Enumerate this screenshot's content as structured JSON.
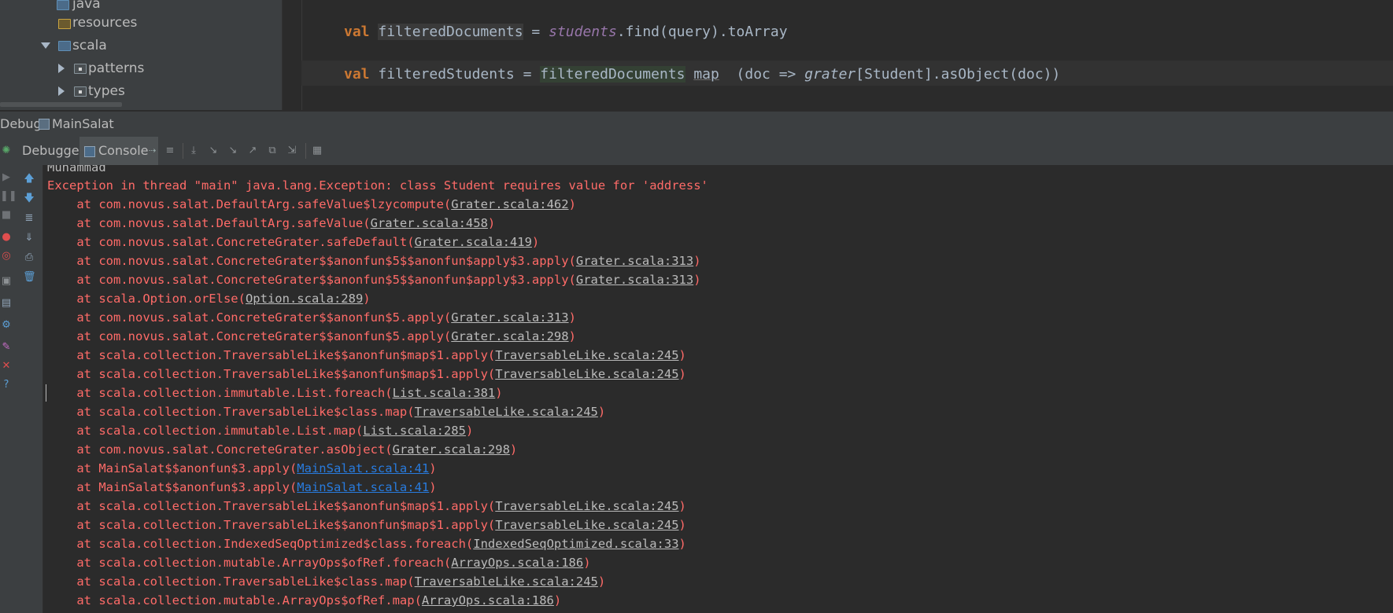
{
  "project_tree": {
    "items": [
      {
        "label": "java",
        "kind": "folder"
      },
      {
        "label": "resources",
        "kind": "resources"
      },
      {
        "label": "scala",
        "kind": "source",
        "expanded": true
      },
      {
        "label": "patterns",
        "kind": "package",
        "expanded": false
      },
      {
        "label": "types",
        "kind": "package",
        "expanded": false
      }
    ]
  },
  "editor": {
    "line1": {
      "kw": "val",
      "var": "filteredDocuments",
      "eq": " = ",
      "recv": "students",
      "rest": ".find(query).toArray"
    },
    "line2": {
      "kw": "val",
      "var": "filteredStudents",
      "eq": " = ",
      "recv": "filteredDocuments",
      "sp": " ",
      "map": "map",
      "p1": "  (doc => ",
      "grater": "grater",
      "rest": "[Student].asObject(doc))"
    }
  },
  "debug": {
    "title": "Debug",
    "config": "MainSalat",
    "tabs": {
      "debugger": "Debugger",
      "console": "Console"
    }
  },
  "colors": {
    "error": "#ff6b68",
    "link": "#bbbbbb",
    "link_own": "#287bde",
    "keyword": "#cc7832",
    "field": "#9876aa"
  },
  "console": {
    "partial_top": "Muhammad",
    "lines": [
      {
        "t": "Exception in thread \"main\" java.lang.Exception: class Student requires value for 'address'"
      },
      {
        "t": "    at com.novus.salat.DefaultArg.safeValue$lzycompute(",
        "link": "Grater.scala:462",
        "end": ")"
      },
      {
        "t": "    at com.novus.salat.DefaultArg.safeValue(",
        "link": "Grater.scala:458",
        "end": ")"
      },
      {
        "t": "    at com.novus.salat.ConcreteGrater.safeDefault(",
        "link": "Grater.scala:419",
        "end": ")"
      },
      {
        "t": "    at com.novus.salat.ConcreteGrater$$anonfun$5$$anonfun$apply$3.apply(",
        "link": "Grater.scala:313",
        "end": ")"
      },
      {
        "t": "    at com.novus.salat.ConcreteGrater$$anonfun$5$$anonfun$apply$3.apply(",
        "link": "Grater.scala:313",
        "end": ")"
      },
      {
        "t": "    at scala.Option.orElse(",
        "link": "Option.scala:289",
        "end": ")"
      },
      {
        "t": "    at com.novus.salat.ConcreteGrater$$anonfun$5.apply(",
        "link": "Grater.scala:313",
        "end": ")"
      },
      {
        "t": "    at com.novus.salat.ConcreteGrater$$anonfun$5.apply(",
        "link": "Grater.scala:298",
        "end": ")"
      },
      {
        "t": "    at scala.collection.TraversableLike$$anonfun$map$1.apply(",
        "link": "TraversableLike.scala:245",
        "end": ")"
      },
      {
        "t": "    at scala.collection.TraversableLike$$anonfun$map$1.apply(",
        "link": "TraversableLike.scala:245",
        "end": ")"
      },
      {
        "t": "    at scala.collection.immutable.List.foreach(",
        "link": "List.scala:381",
        "end": ")"
      },
      {
        "t": "    at scala.collection.TraversableLike$class.map(",
        "link": "TraversableLike.scala:245",
        "end": ")"
      },
      {
        "t": "    at scala.collection.immutable.List.map(",
        "link": "List.scala:285",
        "end": ")"
      },
      {
        "t": "    at com.novus.salat.ConcreteGrater.asObject(",
        "link": "Grater.scala:298",
        "end": ")"
      },
      {
        "t": "    at MainSalat$$anonfun$3.apply(",
        "link": "MainSalat.scala:41",
        "end": ")",
        "own": true
      },
      {
        "t": "    at MainSalat$$anonfun$3.apply(",
        "link": "MainSalat.scala:41",
        "end": ")",
        "own": true
      },
      {
        "t": "    at scala.collection.TraversableLike$$anonfun$map$1.apply(",
        "link": "TraversableLike.scala:245",
        "end": ")"
      },
      {
        "t": "    at scala.collection.TraversableLike$$anonfun$map$1.apply(",
        "link": "TraversableLike.scala:245",
        "end": ")"
      },
      {
        "t": "    at scala.collection.IndexedSeqOptimized$class.foreach(",
        "link": "IndexedSeqOptimized.scala:33",
        "end": ")"
      },
      {
        "t": "    at scala.collection.mutable.ArrayOps$ofRef.foreach(",
        "link": "ArrayOps.scala:186",
        "end": ")"
      },
      {
        "t": "    at scala.collection.TraversableLike$class.map(",
        "link": "TraversableLike.scala:245",
        "end": ")"
      },
      {
        "t": "    at scala.collection.mutable.ArrayOps$ofRef.map(",
        "link": "ArrayOps.scala:186",
        "end": ")"
      }
    ]
  }
}
